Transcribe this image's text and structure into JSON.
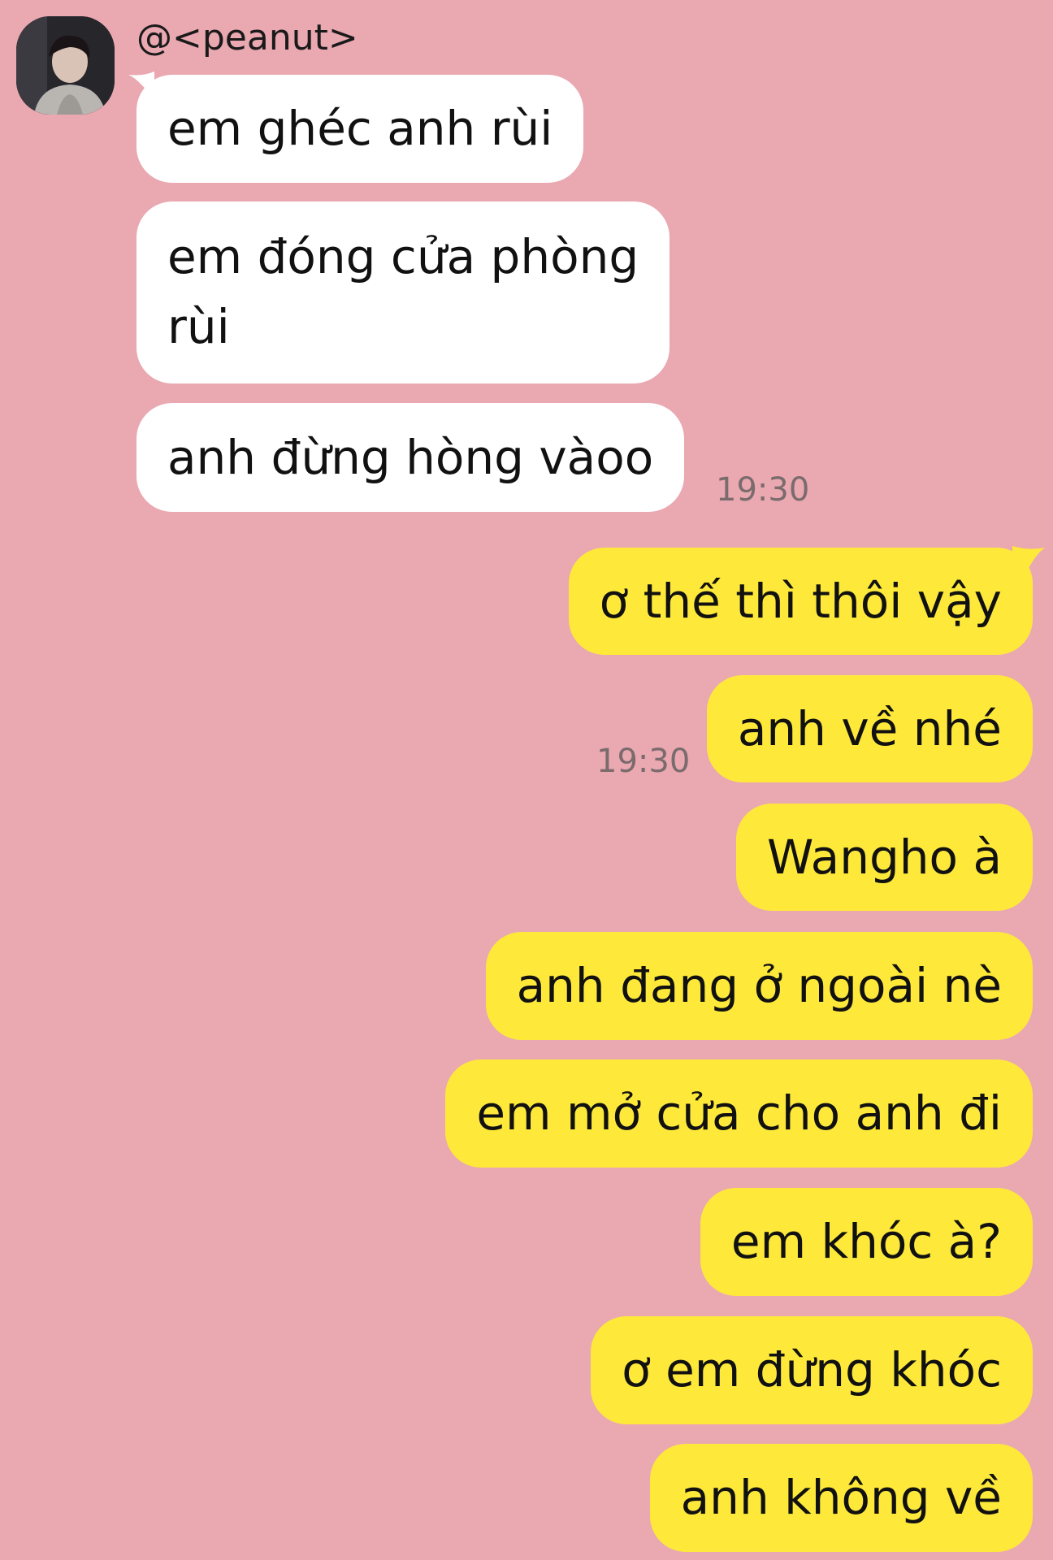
{
  "contact": {
    "name": "@<peanut>"
  },
  "incoming": [
    {
      "text": "em ghéc anh rùi"
    },
    {
      "line1": "em đóng cửa phòng",
      "line2": "rùi"
    },
    {
      "text": "anh đừng hòng vàoo"
    }
  ],
  "incoming_time": "19:30",
  "outgoing": [
    {
      "text": "ơ thế thì thôi vậy"
    },
    {
      "text": "anh về nhé"
    },
    {
      "text": "Wangho à"
    },
    {
      "text": "anh đang ở ngoài nè"
    },
    {
      "text": "em mở cửa cho anh đi"
    },
    {
      "text": "em khóc à?"
    },
    {
      "text": "ơ em đừng khóc"
    },
    {
      "text": "anh không về"
    }
  ],
  "outgoing_time": "19:30",
  "colors": {
    "background": "#eaa8b1",
    "incoming_bubble": "#ffffff",
    "outgoing_bubble": "#fee93a",
    "timestamp": "#7a6b6d"
  },
  "icons": {
    "avatar": "profile-photo-avatar"
  }
}
